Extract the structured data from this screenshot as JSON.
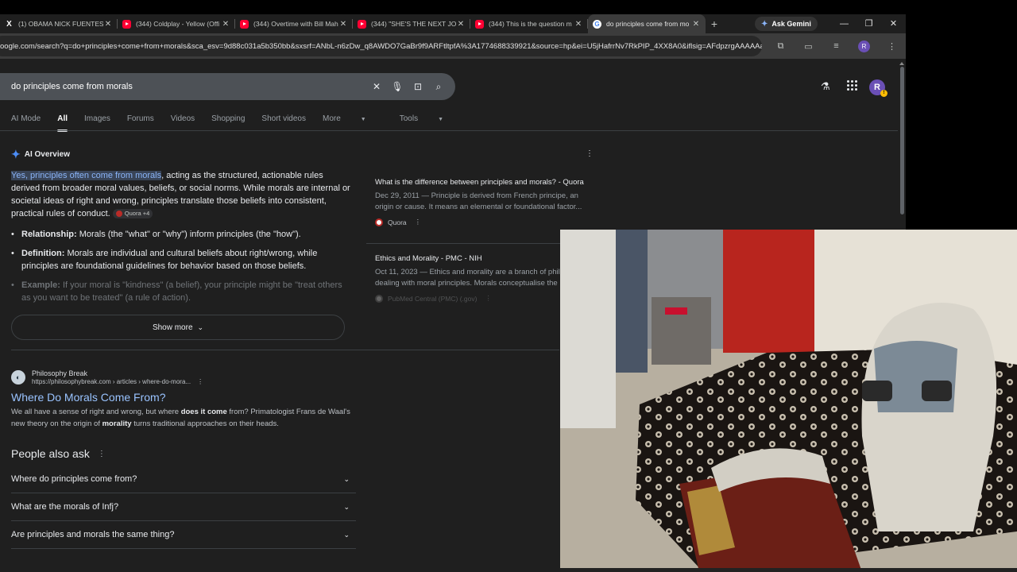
{
  "tabs": [
    {
      "title": "(1) OBAMA NICK FUENTES -",
      "icon": "x-icon"
    },
    {
      "title": "(344) Coldplay - Yellow (Offi",
      "icon": "youtube-icon"
    },
    {
      "title": "(344) Overtime with Bill Mah",
      "icon": "youtube-icon"
    },
    {
      "title": "(344) \"SHE'S THE NEXT JOH",
      "icon": "youtube-icon"
    },
    {
      "title": "(344) This is the question m",
      "icon": "youtube-icon"
    },
    {
      "title": "do principles come from mo",
      "icon": "google-icon",
      "active": true
    }
  ],
  "browser": {
    "ask_gemini": "Ask Gemini",
    "url": "oogle.com/search?q=do+principles+come+from+morals&sca_esv=9d88c031a5b350bb&sxsrf=ANbL-n6zDw_q8AWDO7GaBr9f9ARFtltpfA%3A1774688339921&source=hp&ei=U5jHafrrNv7RkPIP_4XX8A0&iflsig=AFdpzrgAAAAAacem...",
    "profile_initial": "R"
  },
  "search": {
    "query": "do principles come from morals",
    "avatar_initial": "R"
  },
  "nav_tabs": [
    "AI Mode",
    "All",
    "Images",
    "Forums",
    "Videos",
    "Shopping",
    "Short videos",
    "More",
    "Tools"
  ],
  "ai_overview": {
    "label": "AI Overview",
    "highlight": "Yes, principles often come from morals",
    "text_rest": ", acting as the structured, actionable rules derived from broader moral values, beliefs, or social norms. While morals are internal or societal ideas of right and wrong, principles translate those beliefs into consistent, practical rules of conduct.",
    "chip": "Quora +4",
    "bullets": [
      {
        "term": "Relationship:",
        "text": "Morals (the \"what\" or \"why\") inform principles (the \"how\")."
      },
      {
        "term": "Definition:",
        "text": "Morals are individual and cultural beliefs about right/wrong, while principles are foundational guidelines for behavior based on those beliefs."
      },
      {
        "term": "Example:",
        "text": "If your moral is \"kindness\" (a belief), your principle might be \"treat others as you want to be treated\" (a rule of action)."
      }
    ],
    "show_more": "Show more",
    "sources": [
      {
        "title": "What is the difference between principles and morals? - Quora",
        "snippet": "Dec 29, 2011 — Principle is derived from French principe, an origin or cause. It means an elemental or foundational factor...",
        "site": "Quora"
      },
      {
        "title": "Ethics and Morality - PMC - NIH",
        "snippet": "Oct 11, 2023 — Ethics and morality are a branch of philo dealing with moral principles. Morals conceptualise the",
        "site": "PubMed Central (PMC) (.gov)"
      }
    ]
  },
  "result": {
    "site": "Philosophy Break",
    "url": "https://philosophybreak.com › articles › where-do-mora...",
    "title": "Where Do Morals Come From?",
    "snippet_parts": [
      "We all have a sense of right and wrong, but where ",
      "does it come",
      " from? Primatologist Frans de Waal's new theory on the origin of ",
      "morality",
      " turns traditional approaches on their heads."
    ]
  },
  "people_also_ask": {
    "heading": "People also ask",
    "questions": [
      "Where do principles come from?",
      "What are the morals of Infj?",
      "Are principles and morals the same thing?"
    ]
  },
  "colors": {
    "link": "#99c3ff",
    "highlight_bg": "#394457",
    "page_bg": "#1f1f1f"
  }
}
